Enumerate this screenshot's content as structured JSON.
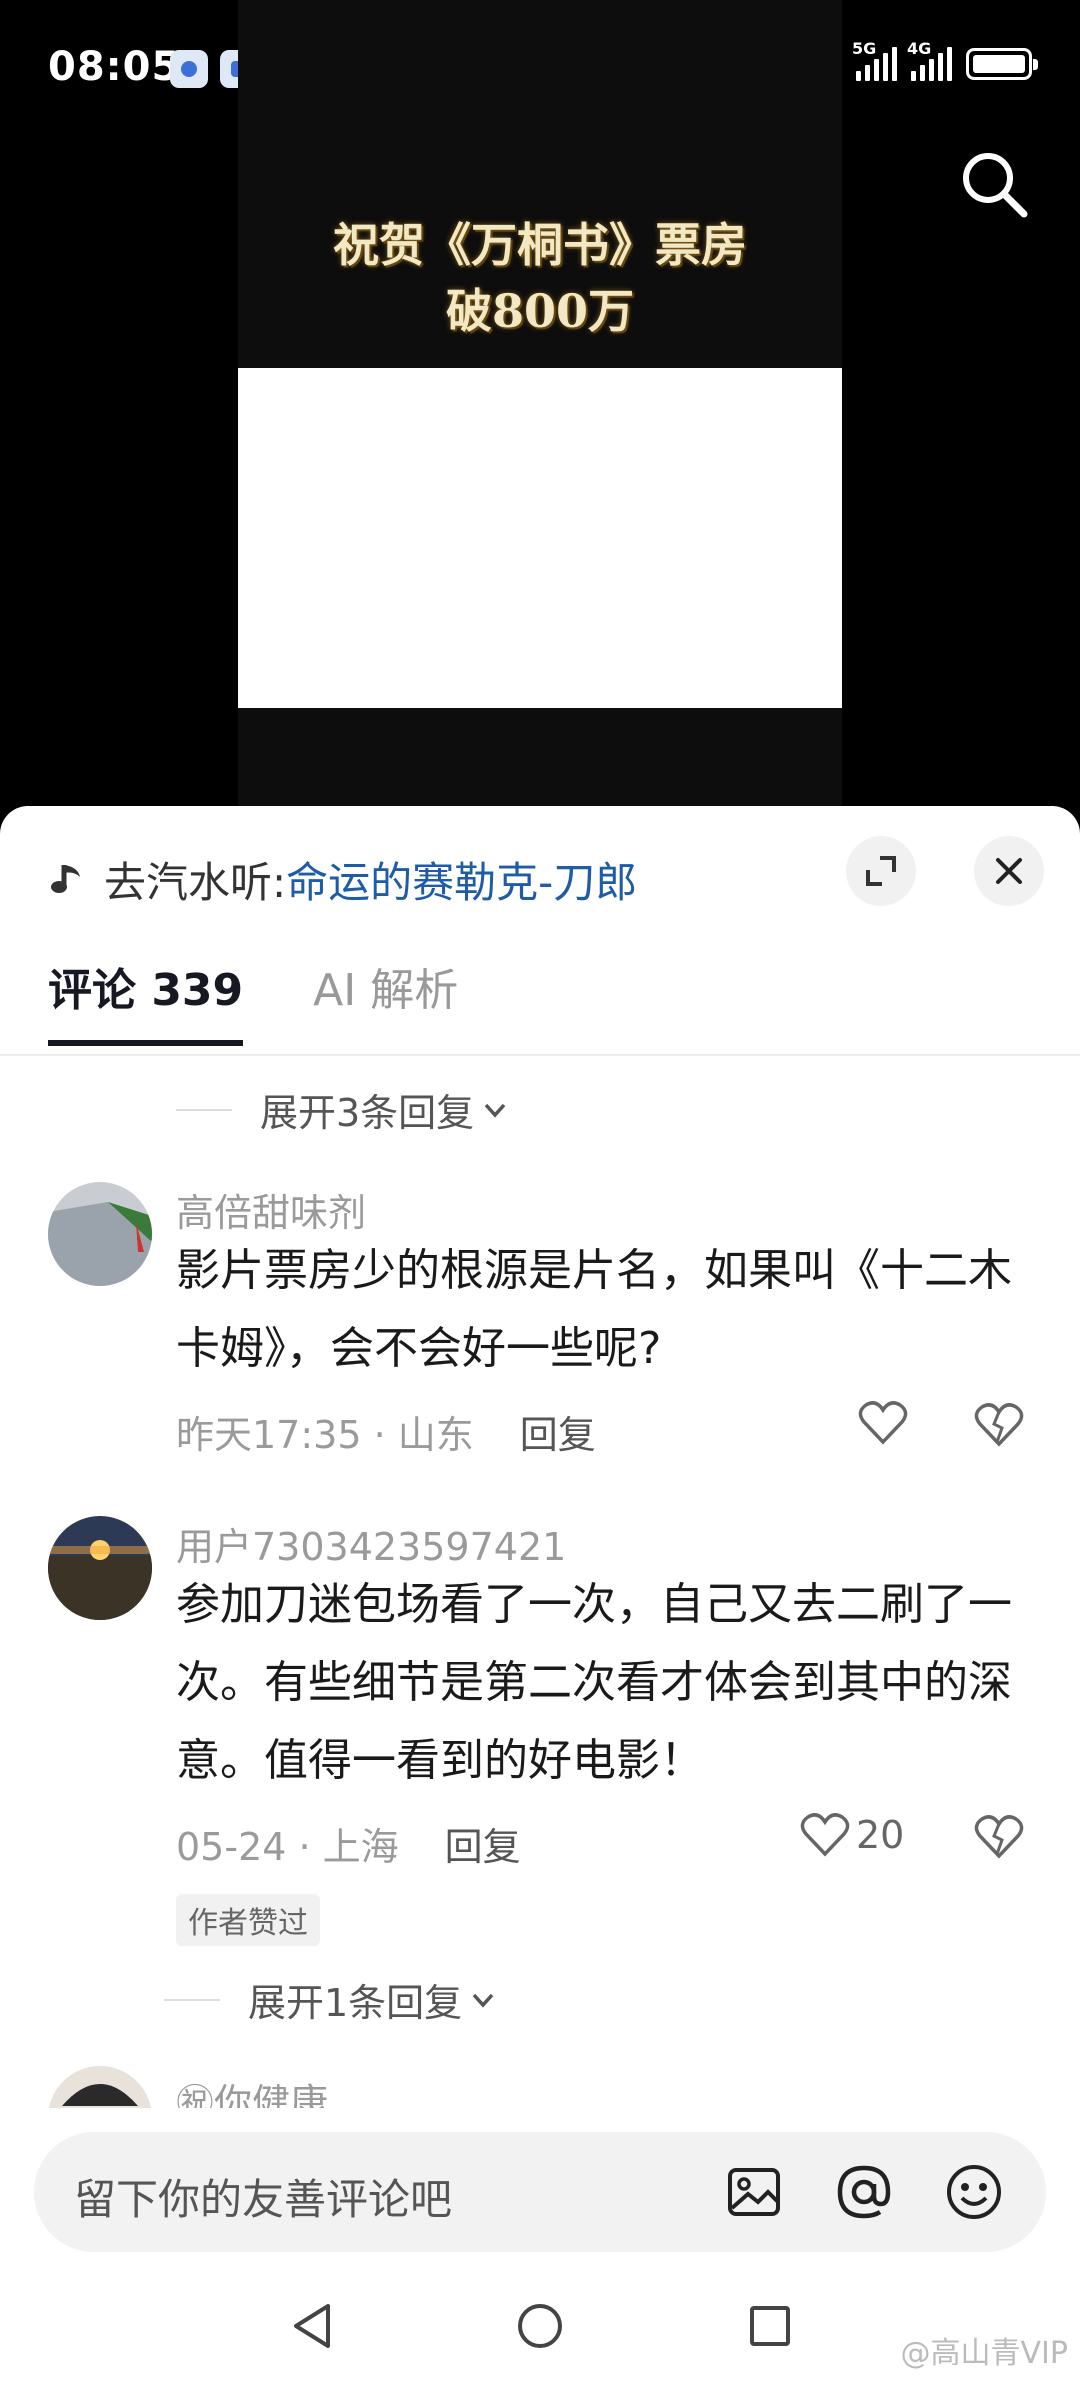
{
  "status_bar": {
    "time": "08:05",
    "signal1_label": "5G",
    "signal2_label": "4G"
  },
  "video": {
    "caption_line1": "祝贺《万桐书》票房",
    "caption_line2": "破800万"
  },
  "sheet": {
    "music_prefix": "去汽水听: ",
    "music_title": "命运的赛勒克-刀郎",
    "tabs": [
      {
        "label": "评论 339",
        "active": true
      },
      {
        "label": "AI 解析",
        "active": false
      }
    ],
    "expand_top": "展开3条回复",
    "comments": [
      {
        "user": "高倍甜味剂",
        "text": "影片票房少的根源是片名，如果叫《十二木卡姆》，会不会好一些呢?",
        "time_location": "昨天17:35 · 山东",
        "reply_label": "回复",
        "likes": ""
      },
      {
        "user": "用户7303423597421",
        "text": "参加刀迷包场看了一次，自己又去二刷了一次。有些细节是第二次看才体会到其中的深意。值得一看到的好电影！",
        "time_location": "05-24 · 上海",
        "reply_label": "回复",
        "likes": "20",
        "badge": "作者赞过",
        "expand": "展开1条回复"
      },
      {
        "user": "㊗你健康"
      }
    ],
    "input_placeholder": "留下你的友善评论吧"
  },
  "watermark": "@高山青VIP",
  "icons": [
    "search-icon",
    "music-note-icon",
    "expand-icon",
    "close-icon",
    "chevron-down-icon",
    "heart-icon",
    "broken-heart-icon",
    "image-icon",
    "at-icon",
    "emoji-icon",
    "back-icon",
    "home-icon",
    "recents-icon"
  ]
}
